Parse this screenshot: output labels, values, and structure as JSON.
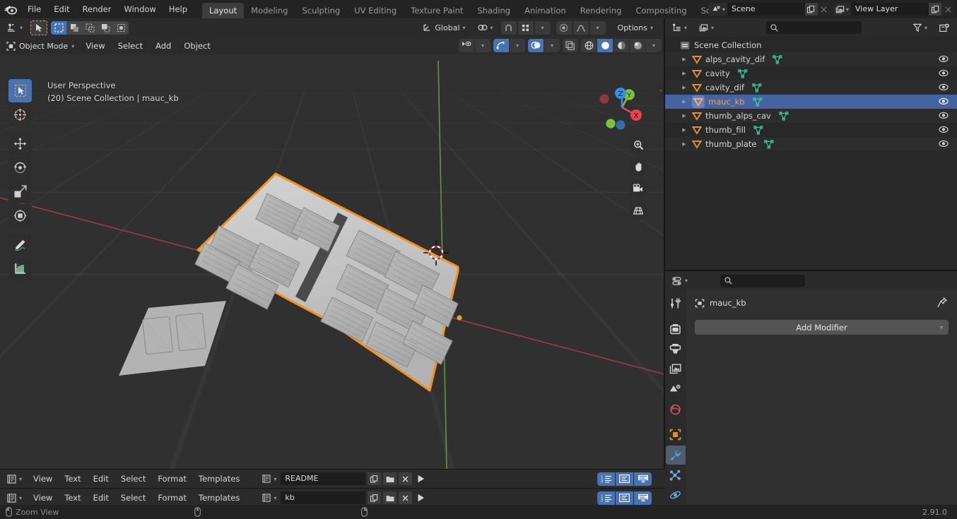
{
  "app": {
    "version": "2.91.0",
    "logo": "blender-logo"
  },
  "topbar": {
    "menus": [
      "File",
      "Edit",
      "Render",
      "Window",
      "Help"
    ],
    "tabs": [
      {
        "label": "Layout",
        "active": true
      },
      {
        "label": "Modeling",
        "active": false
      },
      {
        "label": "Sculpting",
        "active": false
      },
      {
        "label": "UV Editing",
        "active": false
      },
      {
        "label": "Texture Paint",
        "active": false
      },
      {
        "label": "Shading",
        "active": false
      },
      {
        "label": "Animation",
        "active": false
      },
      {
        "label": "Rendering",
        "active": false
      },
      {
        "label": "Compositing",
        "active": false
      },
      {
        "label": "Scripting",
        "active": false
      }
    ],
    "scene": {
      "name": "Scene",
      "icon": "scene-icon",
      "copy": "copy-icon",
      "delete": "x-icon"
    },
    "view_layer": {
      "name": "View Layer",
      "icon": "view-layer-icon",
      "copy": "copy-icon",
      "delete": "x-icon"
    }
  },
  "viewport": {
    "tool_header": {
      "transform_orientation": "Global",
      "options_label": "Options",
      "snap_icon": "magnet-icon",
      "proportional_icon": "proportional-editing-icon"
    },
    "mode": "Object Mode",
    "menus": [
      "View",
      "Select",
      "Add",
      "Object"
    ],
    "overlay_text_line1": "User Perspective",
    "overlay_text_line2": "(20) Scene Collection | mauc_kb",
    "tools": [
      {
        "name": "tweak-select-tool",
        "active": true
      },
      {
        "name": "cursor-tool",
        "active": false
      },
      {
        "name": "move-tool",
        "active": false
      },
      {
        "name": "rotate-tool",
        "active": false
      },
      {
        "name": "scale-tool",
        "active": false
      },
      {
        "name": "transform-tool",
        "active": false
      },
      {
        "name": "annotate-tool",
        "active": false
      },
      {
        "name": "measure-tool",
        "active": false
      }
    ],
    "gizmos": [
      "zoom-gizmo",
      "pan-gizmo",
      "camera-gizmo",
      "ortho-toggle-gizmo"
    ],
    "axis_labels": {
      "x": "X",
      "y": "Y",
      "z": "Z"
    },
    "shading_modes": [
      "wireframe",
      "solid",
      "material-preview",
      "rendered"
    ],
    "shading_active": "solid",
    "object_color": "#c2c2c2",
    "selection_outline_color": "#f5921e"
  },
  "outliner": {
    "filter_icon": "filter-icon",
    "new_collection_icon": "new-collection-icon",
    "display_mode_icon": "outliner-display-mode-icon",
    "search_placeholder": "",
    "root": {
      "label": "Scene Collection",
      "icon": "collection-icon"
    },
    "items": [
      {
        "label": "alps_cavity_dif",
        "icon": "object-mesh-icon",
        "data_icon": "mesh-data-icon",
        "selected": false,
        "visible": true
      },
      {
        "label": "cavity",
        "icon": "object-mesh-icon",
        "data_icon": "mesh-data-icon",
        "selected": false,
        "visible": true
      },
      {
        "label": "cavity_dif",
        "icon": "object-mesh-icon",
        "data_icon": "mesh-data-icon",
        "selected": false,
        "visible": true
      },
      {
        "label": "mauc_kb",
        "icon": "object-mesh-icon",
        "data_icon": "mesh-data-icon",
        "selected": true,
        "visible": true
      },
      {
        "label": "thumb_alps_cav",
        "icon": "object-mesh-icon",
        "data_icon": "mesh-data-icon",
        "selected": false,
        "visible": true
      },
      {
        "label": "thumb_fill",
        "icon": "object-mesh-icon",
        "data_icon": "mesh-data-icon",
        "selected": false,
        "visible": true
      },
      {
        "label": "thumb_plate",
        "icon": "object-mesh-icon",
        "data_icon": "mesh-data-icon",
        "selected": false,
        "visible": true
      }
    ]
  },
  "properties": {
    "editor_icon": "properties-editor-icon",
    "search_placeholder": "",
    "breadcrumb_object": "mauc_kb",
    "breadcrumb_icon": "object-icon",
    "pin_icon": "pin-icon",
    "add_modifier_label": "Add Modifier",
    "tabs": [
      {
        "name": "tool-tab",
        "active": false
      },
      {
        "name": "render-tab",
        "active": false
      },
      {
        "name": "output-tab",
        "active": false
      },
      {
        "name": "view-layer-tab",
        "active": false
      },
      {
        "name": "scene-tab",
        "active": false
      },
      {
        "name": "world-tab",
        "active": false
      },
      {
        "name": "object-tab",
        "active": false
      },
      {
        "name": "modifier-tab",
        "active": true
      },
      {
        "name": "particles-tab",
        "active": false
      },
      {
        "name": "physics-tab",
        "active": false
      }
    ]
  },
  "text_editors": [
    {
      "menus": [
        "View",
        "Text",
        "Edit",
        "Select",
        "Format",
        "Templates"
      ],
      "filename": "README",
      "new_icon": "new-text-icon",
      "open_icon": "open-folder-icon",
      "close_icon": "x-icon",
      "run_icon": "run-script-icon",
      "toggles": [
        "line-numbers-toggle",
        "word-wrap-toggle",
        "syntax-highlight-toggle"
      ]
    },
    {
      "menus": [
        "View",
        "Text",
        "Edit",
        "Select",
        "Format",
        "Templates"
      ],
      "filename": "kb",
      "new_icon": "new-text-icon",
      "open_icon": "open-folder-icon",
      "close_icon": "x-icon",
      "run_icon": "run-script-icon",
      "toggles": [
        "line-numbers-toggle",
        "word-wrap-toggle",
        "syntax-highlight-toggle"
      ]
    }
  ],
  "statusbar": {
    "hint": "Zoom View",
    "mouse_icons": [
      "mouse-left-icon",
      "mouse-middle-icon",
      "mouse-right-icon"
    ],
    "version": "2.91.0"
  }
}
